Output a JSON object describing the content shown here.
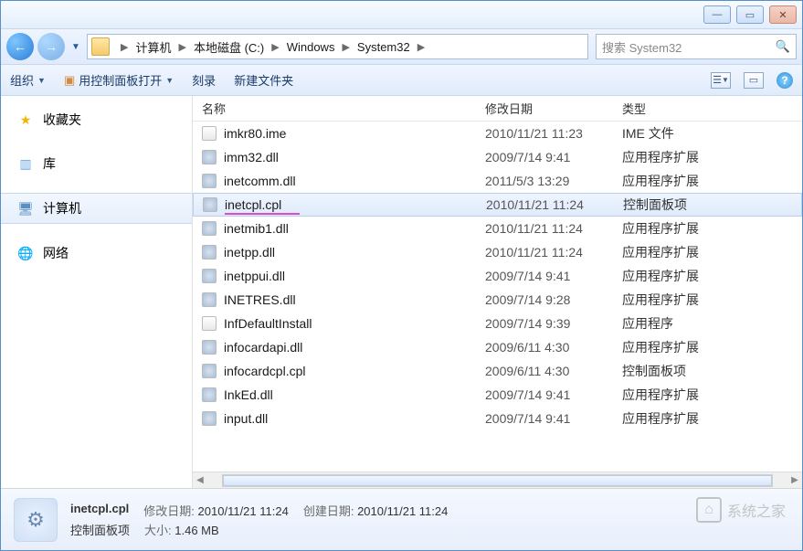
{
  "titlebar": {
    "min": "—",
    "max": "▭",
    "close": "✕"
  },
  "nav": {
    "back": "←",
    "fwd": "→",
    "crumbs": [
      "计算机",
      "本地磁盘 (C:)",
      "Windows",
      "System32"
    ],
    "search_placeholder": "搜索 System32"
  },
  "toolbar": {
    "organize": "组织",
    "open_cp": "用控制面板打开",
    "burn": "刻录",
    "newfolder": "新建文件夹"
  },
  "sidebar": {
    "favorites": "收藏夹",
    "libraries": "库",
    "computer": "计算机",
    "network": "网络"
  },
  "columns": {
    "name": "名称",
    "date": "修改日期",
    "type": "类型"
  },
  "files": [
    {
      "name": "imkr80.ime",
      "date": "2010/11/21 11:23",
      "type": "IME 文件",
      "icon": "file"
    },
    {
      "name": "imm32.dll",
      "date": "2009/7/14 9:41",
      "type": "应用程序扩展",
      "icon": "gear"
    },
    {
      "name": "inetcomm.dll",
      "date": "2011/5/3 13:29",
      "type": "应用程序扩展",
      "icon": "gear"
    },
    {
      "name": "inetcpl.cpl",
      "date": "2010/11/21 11:24",
      "type": "控制面板项",
      "icon": "gear",
      "selected": true,
      "underlined": true
    },
    {
      "name": "inetmib1.dll",
      "date": "2010/11/21 11:24",
      "type": "应用程序扩展",
      "icon": "gear"
    },
    {
      "name": "inetpp.dll",
      "date": "2010/11/21 11:24",
      "type": "应用程序扩展",
      "icon": "gear"
    },
    {
      "name": "inetppui.dll",
      "date": "2009/7/14 9:41",
      "type": "应用程序扩展",
      "icon": "gear"
    },
    {
      "name": "INETRES.dll",
      "date": "2009/7/14 9:28",
      "type": "应用程序扩展",
      "icon": "gear"
    },
    {
      "name": "InfDefaultInstall",
      "date": "2009/7/14 9:39",
      "type": "应用程序",
      "icon": "file"
    },
    {
      "name": "infocardapi.dll",
      "date": "2009/6/11 4:30",
      "type": "应用程序扩展",
      "icon": "gear"
    },
    {
      "name": "infocardcpl.cpl",
      "date": "2009/6/11 4:30",
      "type": "控制面板项",
      "icon": "gear"
    },
    {
      "name": "InkEd.dll",
      "date": "2009/7/14 9:41",
      "type": "应用程序扩展",
      "icon": "gear"
    },
    {
      "name": "input.dll",
      "date": "2009/7/14 9:41",
      "type": "应用程序扩展",
      "icon": "gear"
    }
  ],
  "details": {
    "filename": "inetcpl.cpl",
    "filetype": "控制面板项",
    "moddate_label": "修改日期:",
    "moddate": "2010/11/21 11:24",
    "created_label": "创建日期:",
    "created": "2010/11/21 11:24",
    "size_label": "大小:",
    "size": "1.46 MB"
  },
  "watermark": "系统之家"
}
